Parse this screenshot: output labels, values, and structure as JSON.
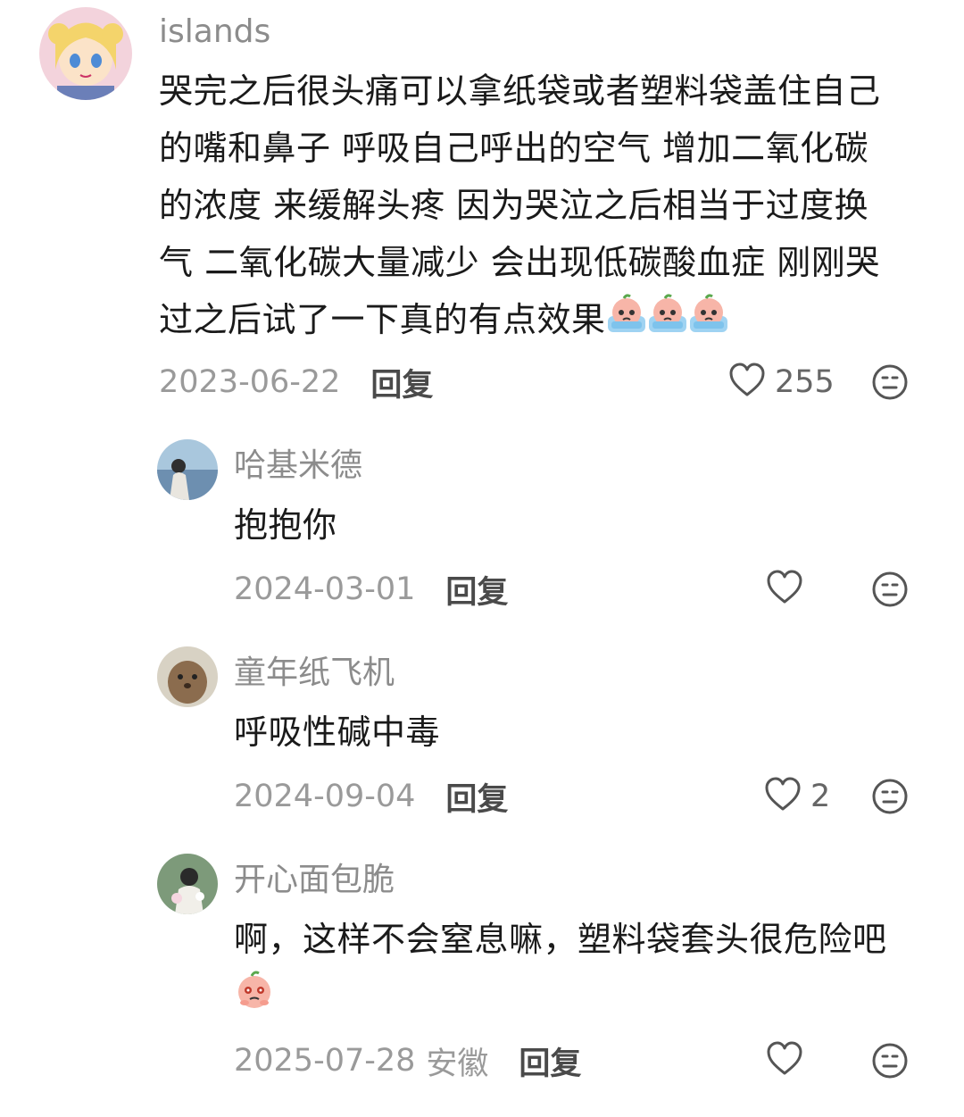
{
  "comments": [
    {
      "username": "islands",
      "content_lines": [
        "哭完之后很头痛可以拿纸袋或者塑料袋盖住自己",
        "的嘴和鼻子 呼吸自己呼出的空气 增加二氧化碳",
        "的浓度 来缓解头疼 因为哭泣之后相当于过度换",
        "气 二氧化碳大量减少 会出现低碳酸血症 刚刚哭",
        "过之后试了一下真的有点效果"
      ],
      "date": "2023-06-22",
      "reply_label": "回复",
      "like_count": "255",
      "avatar_icon": "anime-girl-avatar",
      "emojis": [
        "crying-peach-emoji",
        "crying-peach-emoji",
        "crying-peach-emoji"
      ]
    },
    {
      "username": "哈基米德",
      "content_lines": [
        "抱抱你"
      ],
      "date": "2024-03-01",
      "reply_label": "回复",
      "like_count": "",
      "avatar_icon": "person-by-sea-avatar"
    },
    {
      "username": "童年纸飞机",
      "content_lines": [
        "呼吸性碱中毒"
      ],
      "date": "2024-09-04",
      "reply_label": "回复",
      "like_count": "2",
      "avatar_icon": "quokka-avatar"
    },
    {
      "username": "开心面包脆",
      "content_lines": [
        "啊，这样不会窒息嘛，塑料袋套头很危险吧"
      ],
      "date": "2025-07-28",
      "location": "安徽",
      "reply_label": "回复",
      "like_count": "",
      "avatar_icon": "girl-with-flowers-avatar",
      "emojis": [
        "worried-peach-emoji"
      ]
    }
  ],
  "colors": {
    "username": "#8c8c8c",
    "date": "#9a9a9a",
    "icon_stroke": "#555555"
  }
}
